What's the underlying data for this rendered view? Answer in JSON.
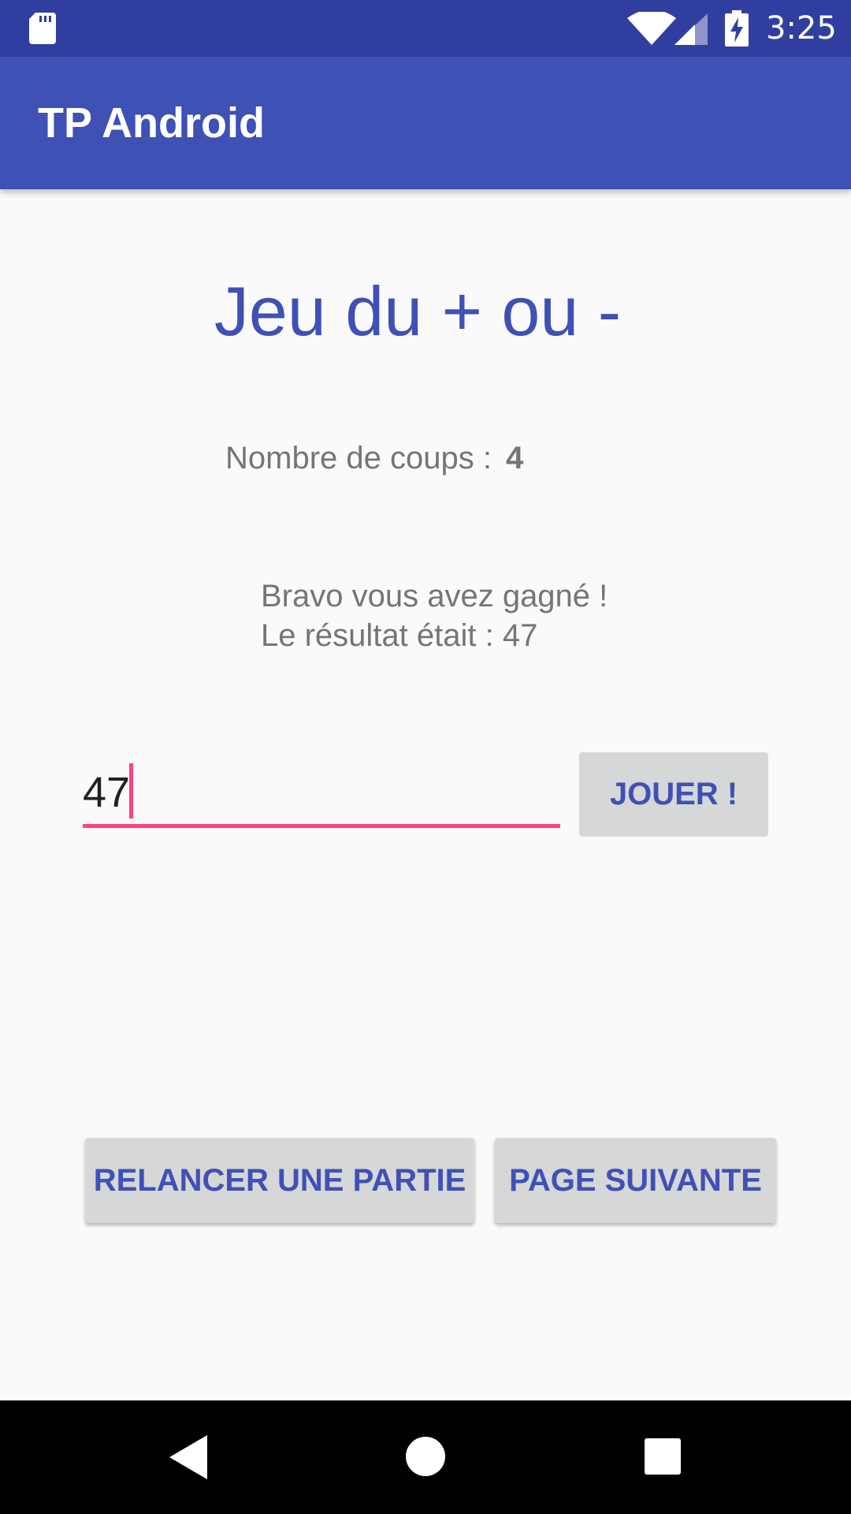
{
  "status_bar": {
    "time": "3:25",
    "icons": [
      "sd-card-icon",
      "wifi-icon",
      "cell-signal-icon",
      "battery-charging-icon"
    ]
  },
  "app_bar": {
    "title": "TP Android"
  },
  "game": {
    "title": "Jeu du + ou -",
    "coups_label": "Nombre de coups :",
    "coups_value": "4",
    "result_line1": "Bravo vous avez gagné !",
    "result_line2": "Le résultat était : 47",
    "guess_value": "47",
    "play_button": "JOUER !"
  },
  "actions": {
    "restart_button": "RELANCER UNE PARTIE",
    "next_page_button": "PAGE SUIVANTE"
  },
  "nav_bar": {
    "icons": [
      "back-icon",
      "home-icon",
      "recents-icon"
    ]
  },
  "colors": {
    "status_bar": "#303f9f",
    "app_bar": "#3f51b5",
    "accent": "#ff4081",
    "button_bg": "#d6d7d7",
    "button_text": "#3f51b5",
    "secondary_text": "#757575"
  }
}
